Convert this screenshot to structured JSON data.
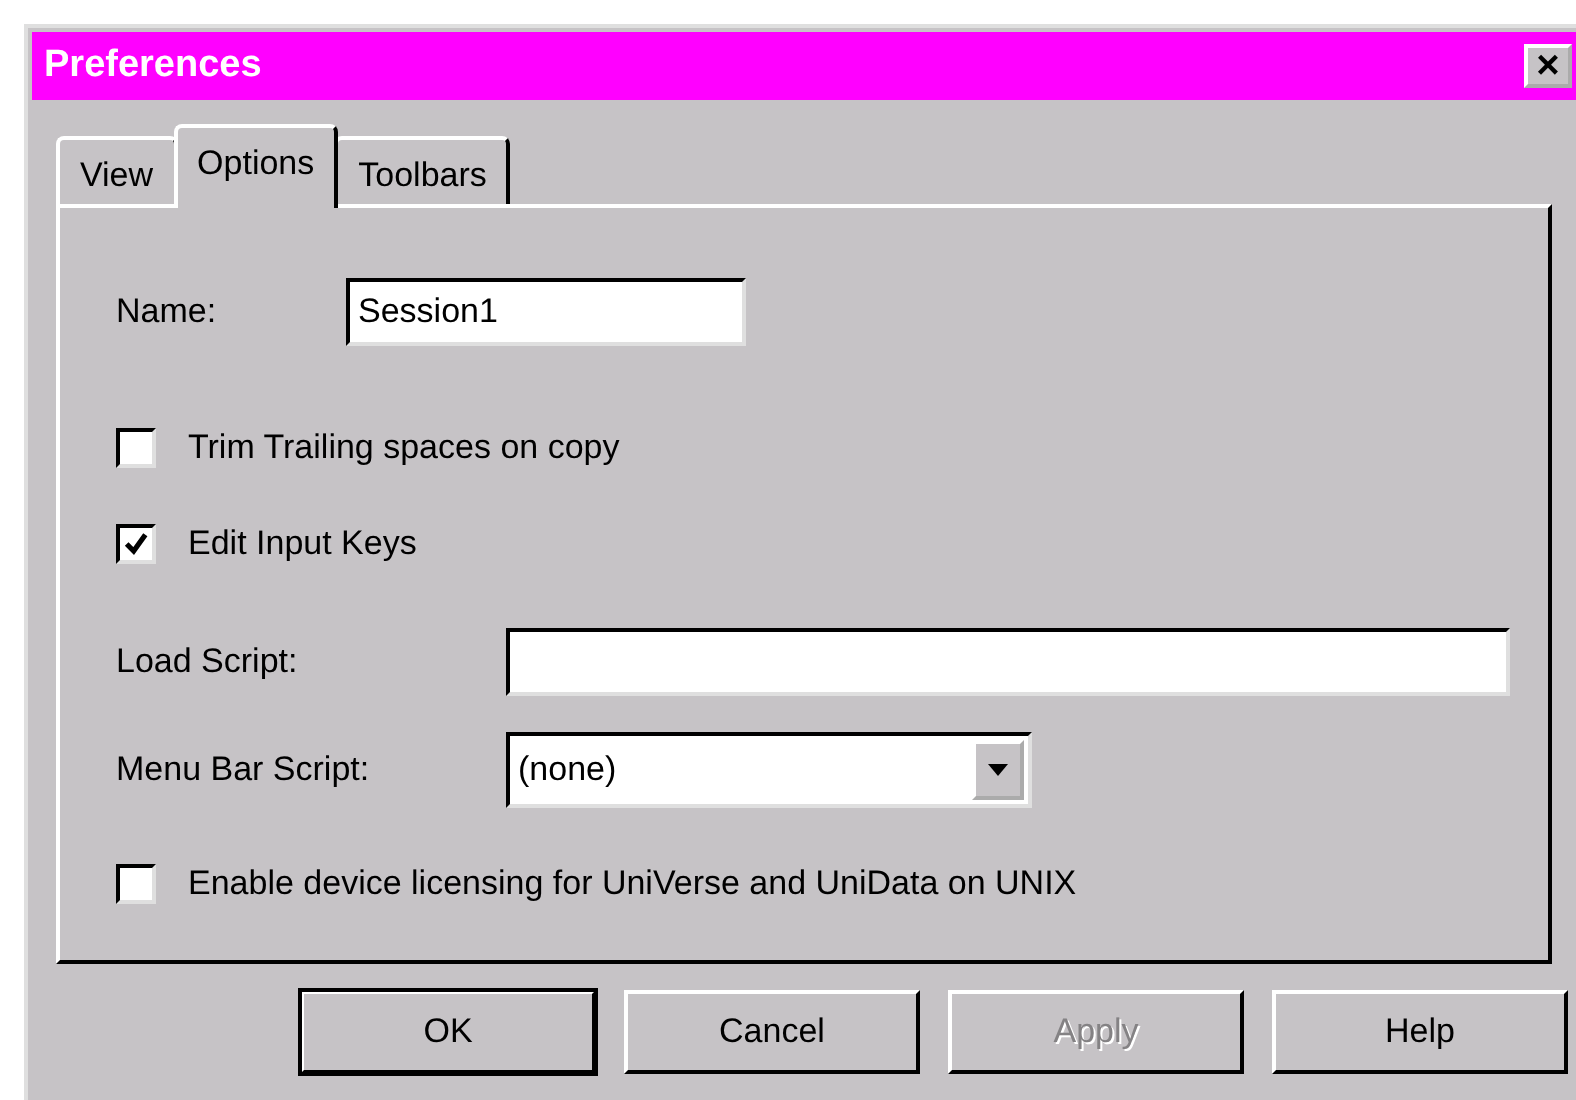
{
  "window": {
    "title": "Preferences",
    "close": "×"
  },
  "tabs": [
    {
      "label": "View",
      "selected": false
    },
    {
      "label": "Options",
      "selected": true
    },
    {
      "label": "Toolbars",
      "selected": false
    }
  ],
  "name_field": {
    "label": "Name:",
    "value": "Session1"
  },
  "checkboxes": [
    {
      "label": "Trim Trailing spaces on copy",
      "checked": false
    },
    {
      "label": "Edit Input Keys",
      "checked": true
    }
  ],
  "load_script": {
    "label": "Load Script:"
  },
  "menu_bar_script": {
    "label": "Menu Bar Script:",
    "value": "(none)"
  },
  "licensing": {
    "label": "Enable device licensing for UniVerse and UniData on UNIX",
    "checked": false
  },
  "buttons": [
    {
      "label": "OK",
      "default": true,
      "disabled": false
    },
    {
      "label": "Cancel",
      "default": false,
      "disabled": false
    },
    {
      "label": "Apply",
      "default": false,
      "disabled": true
    },
    {
      "label": "Help",
      "default": false,
      "disabled": false
    }
  ]
}
